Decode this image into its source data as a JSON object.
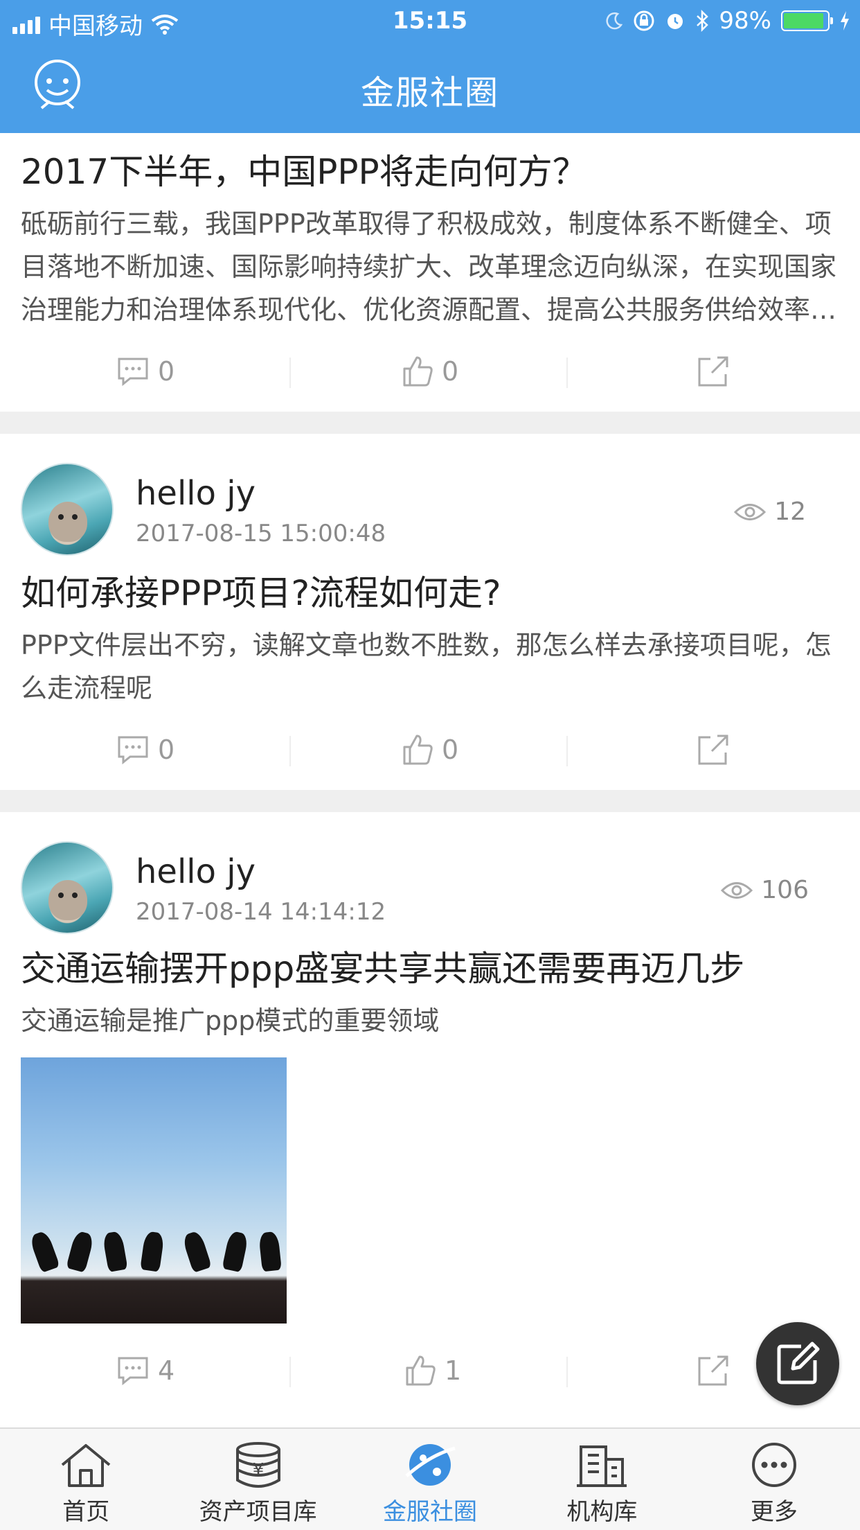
{
  "status_bar": {
    "carrier": "中国移动",
    "time": "15:15",
    "battery": "98%"
  },
  "header": {
    "title": "金服社圈"
  },
  "posts": [
    {
      "title": "2017下半年，中国PPP将走向何方？",
      "body": "砥砺前行三载，我国PPP改革取得了积极成效，制度体系不断健全、项目落地不断加速、国际影响持续扩大、改革理念迈向纵深，在实现国家治理能力和治理体系现代化、优化资源配置、提高公共服务供给效率等方面发挥了积极作用",
      "comments": "0",
      "likes": "0"
    },
    {
      "author": "hello jy",
      "time": "2017-08-15 15:00:48",
      "views": "12",
      "title": "如何承接PPP项目?流程如何走?",
      "body": "PPP文件层出不穷，读解文章也数不胜数，那怎么样去承接项目呢，怎么走流程呢",
      "comments": "0",
      "likes": "0"
    },
    {
      "author": "hello jy",
      "time": "2017-08-14 14:14:12",
      "views": "106",
      "title": "交通运输摆开ppp盛宴共享共赢还需要再迈几步",
      "body": "交通运输是推广ppp模式的重要领域",
      "comments": "4",
      "likes": "1"
    }
  ],
  "tabs": [
    {
      "label": "首页",
      "icon": "home-icon"
    },
    {
      "label": "资产项目库",
      "icon": "coin-stack-icon"
    },
    {
      "label": "金服社圈",
      "icon": "planet-icon",
      "active": true
    },
    {
      "label": "机构库",
      "icon": "building-icon"
    },
    {
      "label": "更多",
      "icon": "more-icon"
    }
  ],
  "colors": {
    "accent": "#4a9ee8",
    "tab_active": "#3b8fe0"
  }
}
